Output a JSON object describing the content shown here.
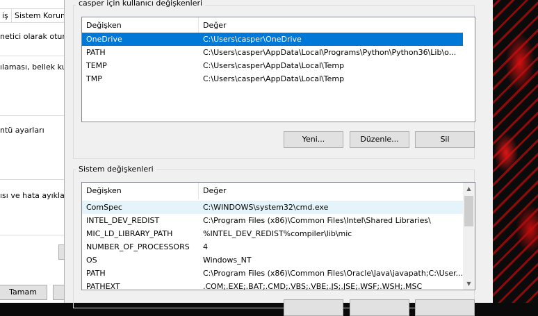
{
  "back_window": {
    "tabs": [
      "iş",
      "Sistem Koruma"
    ],
    "lines": [
      "netici olarak oturum a",
      "ılaması, bellek kullan",
      "ntü ayarları",
      "ısı ve hata ayıklama"
    ],
    "ok_button": "Tamam"
  },
  "user_vars": {
    "group_title": "casper için kullanıcı değişkenleri",
    "columns": [
      "Değişken",
      "Değer"
    ],
    "rows": [
      {
        "name": "OneDrive",
        "value": "C:\\Users\\casper\\OneDrive"
      },
      {
        "name": "PATH",
        "value": "C:\\Users\\casper\\AppData\\Local\\Programs\\Python\\Python36\\Lib\\o..."
      },
      {
        "name": "TEMP",
        "value": "C:\\Users\\casper\\AppData\\Local\\Temp"
      },
      {
        "name": "TMP",
        "value": "C:\\Users\\casper\\AppData\\Local\\Temp"
      }
    ],
    "buttons": {
      "new": "Yeni...",
      "edit": "Düzenle...",
      "delete": "Sil"
    }
  },
  "system_vars": {
    "group_title": "Sistem değişkenleri",
    "columns": [
      "Değişken",
      "Değer"
    ],
    "rows": [
      {
        "name": "ComSpec",
        "value": "C:\\WINDOWS\\system32\\cmd.exe"
      },
      {
        "name": "INTEL_DEV_REDIST",
        "value": "C:\\Program Files (x86)\\Common Files\\Intel\\Shared Libraries\\"
      },
      {
        "name": "MIC_LD_LIBRARY_PATH",
        "value": "%INTEL_DEV_REDIST%compiler\\lib\\mic"
      },
      {
        "name": "NUMBER_OF_PROCESSORS",
        "value": "4"
      },
      {
        "name": "OS",
        "value": "Windows_NT"
      },
      {
        "name": "PATH",
        "value": "C:\\Program Files (x86)\\Common Files\\Oracle\\Java\\javapath;C:\\User..."
      },
      {
        "name": "PATHEXT",
        "value": ".COM;.EXE;.BAT;.CMD;.VBS;.VBE;.JS;.JSE;.WSF;.WSH;.MSC"
      }
    ]
  },
  "colors": {
    "selection": "#0078d7",
    "dialog_bg": "#f0f0f0",
    "accent_wallpaper": "#d01010"
  }
}
